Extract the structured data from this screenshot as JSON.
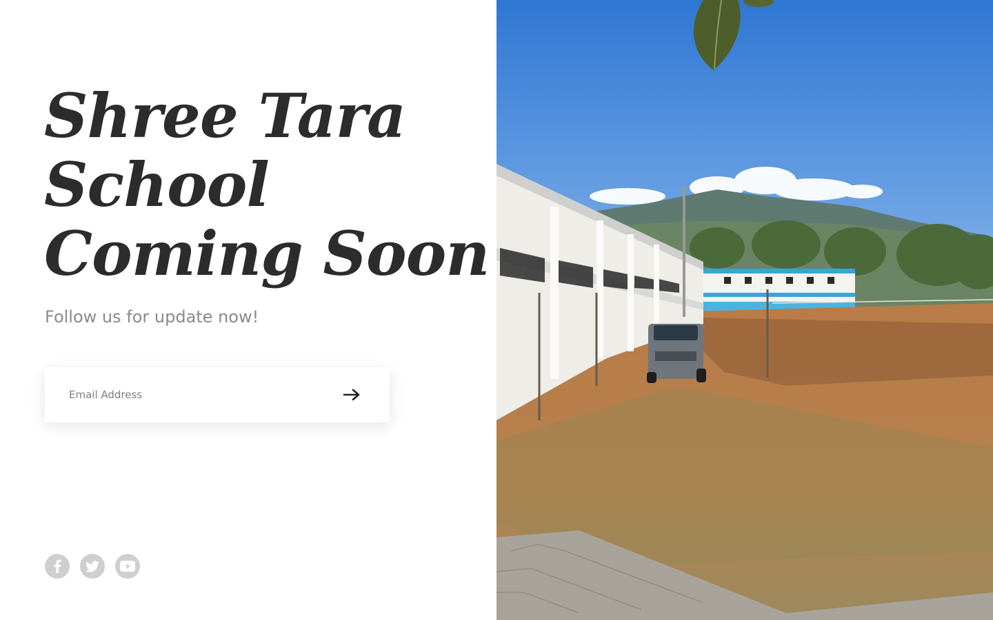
{
  "hero": {
    "title_line1": "Shree Tara",
    "title_line2": "School",
    "title_line3": "Coming Soon",
    "subtitle": "Follow us for update now!"
  },
  "subscribe": {
    "email_placeholder": "Email Address",
    "submit_icon": "arrow-right-icon"
  },
  "social": [
    {
      "icon": "facebook-icon"
    },
    {
      "icon": "twitter-icon"
    },
    {
      "icon": "youtube-icon"
    }
  ],
  "image": {
    "subject": "school campus photo",
    "colors": {
      "sky": "#4a8fd8",
      "ground": "#b5794a"
    }
  },
  "colors": {
    "title": "#2c2c2c",
    "subtitle": "#8a8a8a",
    "social_bg": "#cfcfcf"
  }
}
